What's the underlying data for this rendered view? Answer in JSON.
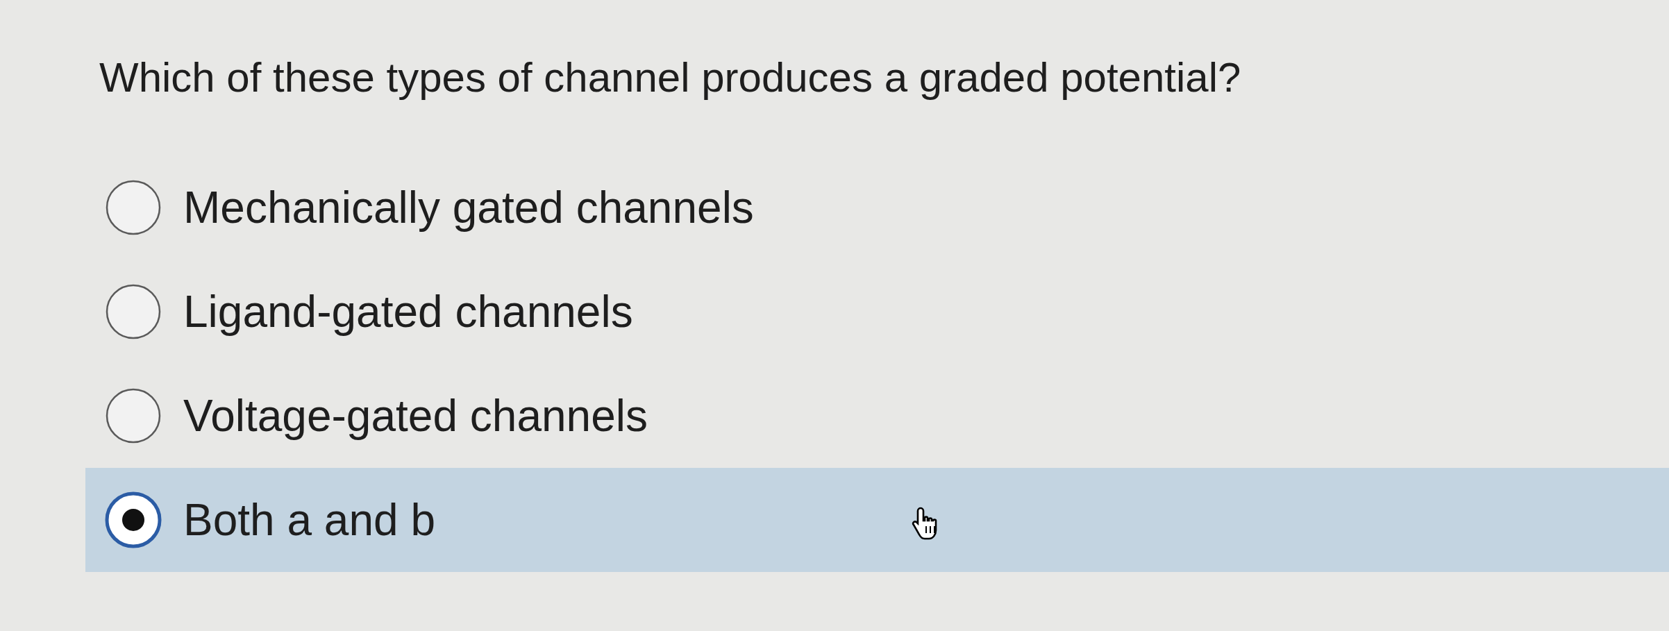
{
  "question": "Which of these types of channel produces a graded potential?",
  "options": [
    {
      "label": "Mechanically gated channels",
      "selected": false
    },
    {
      "label": "Ligand-gated channels",
      "selected": false
    },
    {
      "label": "Voltage-gated channels",
      "selected": false
    },
    {
      "label": "Both a and b",
      "selected": true
    }
  ]
}
